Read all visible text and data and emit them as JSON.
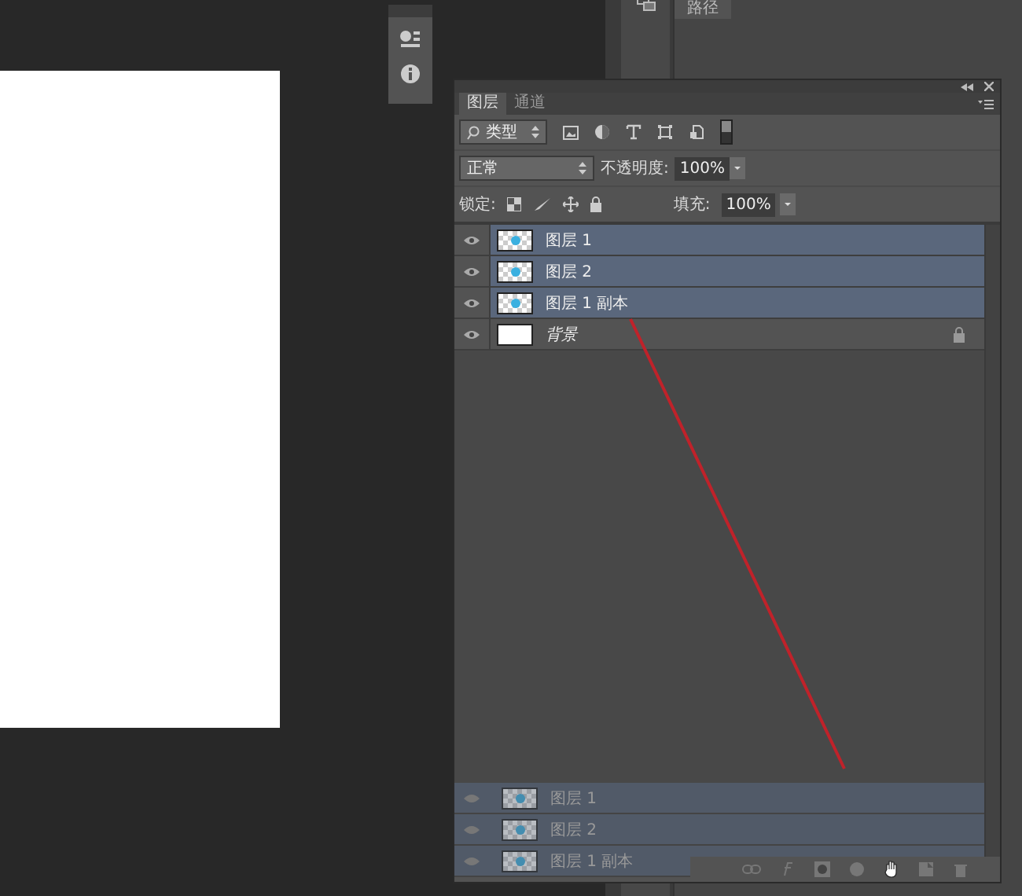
{
  "side_panel": {
    "tab": "路径"
  },
  "layers_panel": {
    "tabs": [
      {
        "label": "图层",
        "selected": true
      },
      {
        "label": "通道",
        "selected": false
      }
    ],
    "filter": {
      "value": "类型"
    },
    "blend_mode": {
      "value": "正常"
    },
    "opacity": {
      "label": "不透明度:",
      "value": "100%"
    },
    "lock": {
      "label": "锁定:"
    },
    "fill": {
      "label": "填充:",
      "value": "100%"
    },
    "layers": [
      {
        "name": "图层 1",
        "selected": true,
        "visible": true,
        "kind": "pixel",
        "locked": false,
        "italic": false
      },
      {
        "name": "图层 2",
        "selected": true,
        "visible": true,
        "kind": "pixel",
        "locked": false,
        "italic": false
      },
      {
        "name": "图层 1 副本",
        "selected": true,
        "visible": true,
        "kind": "pixel",
        "locked": false,
        "italic": false
      },
      {
        "name": "背景",
        "selected": false,
        "visible": true,
        "kind": "background",
        "locked": true,
        "italic": true
      }
    ],
    "drag_preview": [
      "图层 1",
      "图层 2",
      "图层 1 副本"
    ]
  }
}
